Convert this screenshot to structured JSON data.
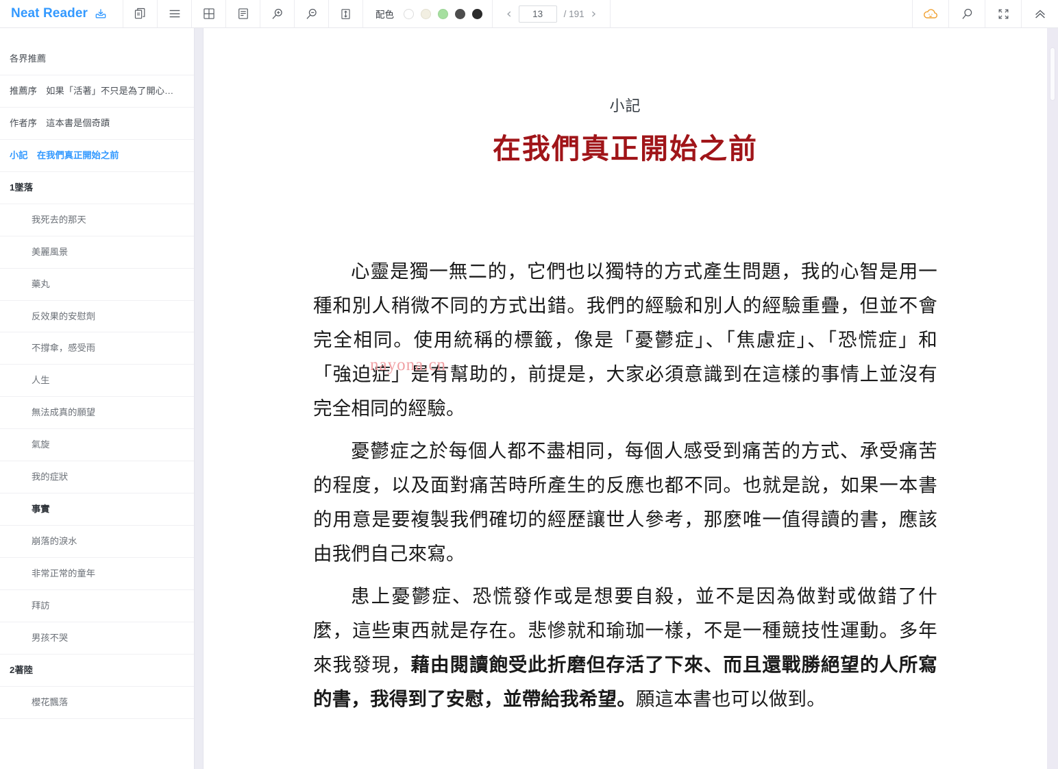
{
  "app": {
    "brand": "Neat Reader",
    "brand_color": "#3399ff",
    "brand_icon": "download-tray-icon"
  },
  "toolbar": {
    "buttons": [
      {
        "name": "pages-copy-icon",
        "title": "分頁"
      },
      {
        "name": "toc-list-icon",
        "title": "目錄"
      },
      {
        "name": "grid-layout-icon",
        "title": "編排"
      },
      {
        "name": "text-layout-icon",
        "title": "排版"
      },
      {
        "name": "zoom-in-icon",
        "title": "放大"
      },
      {
        "name": "zoom-out-icon",
        "title": "縮小"
      },
      {
        "name": "line-height-icon",
        "title": "行高"
      }
    ],
    "color_scheme": {
      "label": "配色",
      "swatches": [
        {
          "name": "scheme-white",
          "color": "#ffffff"
        },
        {
          "name": "scheme-cream",
          "color": "#f2efe2"
        },
        {
          "name": "scheme-green",
          "color": "#a6dfa0"
        },
        {
          "name": "scheme-gray",
          "color": "#4d4d4d"
        },
        {
          "name": "scheme-black",
          "color": "#2b2b2b"
        }
      ]
    },
    "pager": {
      "prev": "‹",
      "next": "›",
      "current_page": "13",
      "total": "/ 191"
    },
    "right_buttons": [
      {
        "name": "cloud-sync-icon",
        "title": "雲端"
      },
      {
        "name": "search-icon",
        "title": "搜尋"
      },
      {
        "name": "fullscreen-icon",
        "title": "全螢幕"
      },
      {
        "name": "collapse-up-icon",
        "title": "收起"
      }
    ],
    "cloud_color": "#f0a030"
  },
  "sidebar": {
    "items": [
      {
        "label": "各界推薦",
        "level": 1,
        "style": "normal",
        "active": false
      },
      {
        "label": "推薦序　如果「活著」不只是為了開心…",
        "level": 1,
        "style": "normal",
        "active": false
      },
      {
        "label": "作者序　這本書是個奇蹟",
        "level": 1,
        "style": "normal",
        "active": false
      },
      {
        "label": "小記　在我們真正開始之前",
        "level": 1,
        "style": "normal",
        "active": true
      },
      {
        "label": "1墜落",
        "level": 1,
        "style": "strong",
        "active": false
      },
      {
        "label": "我死去的那天",
        "level": 2,
        "style": "normal",
        "active": false
      },
      {
        "label": "美麗風景",
        "level": 2,
        "style": "normal",
        "active": false
      },
      {
        "label": "藥丸",
        "level": 2,
        "style": "normal",
        "active": false
      },
      {
        "label": "反效果的安慰劑",
        "level": 2,
        "style": "normal",
        "active": false
      },
      {
        "label": "不撐傘，感受雨",
        "level": 2,
        "style": "normal",
        "active": false
      },
      {
        "label": "人生",
        "level": 2,
        "style": "normal",
        "active": false
      },
      {
        "label": "無法成真的願望",
        "level": 2,
        "style": "normal",
        "active": false
      },
      {
        "label": "氣旋",
        "level": 2,
        "style": "normal",
        "active": false
      },
      {
        "label": "我的症狀",
        "level": 2,
        "style": "normal",
        "active": false
      },
      {
        "label": "事實",
        "level": 2,
        "style": "strong",
        "active": false
      },
      {
        "label": "崩落的淚水",
        "level": 2,
        "style": "normal",
        "active": false
      },
      {
        "label": "非常正常的童年",
        "level": 2,
        "style": "normal",
        "active": false
      },
      {
        "label": "拜訪",
        "level": 2,
        "style": "normal",
        "active": false
      },
      {
        "label": "男孩不哭",
        "level": 2,
        "style": "normal",
        "active": false
      },
      {
        "label": "2著陸",
        "level": 1,
        "style": "strong",
        "active": false
      },
      {
        "label": "櫻花飄落",
        "level": 2,
        "style": "normal",
        "active": false
      }
    ]
  },
  "content": {
    "chapter_label": "小記",
    "chapter_title": "在我們真正開始之前",
    "title_color": "#a01519",
    "watermark": "nayona.cn",
    "paragraphs": {
      "p1": "心靈是獨一無二的，它們也以獨特的方式產生問題，我的心智是用一種和別人稍微不同的方式出錯。我們的經驗和別人的經驗重疊，但並不會完全相同。使用統稱的標籤，像是「憂鬱症」、「焦慮症」、「恐慌症」和「強迫症」是有幫助的，前提是，大家必須意識到在這樣的事情上並沒有完全相同的經驗。",
      "p2": "憂鬱症之於每個人都不盡相同，每個人感受到痛苦的方式、承受痛苦的程度，以及面對痛苦時所產生的反應也都不同。也就是說，如果一本書的用意是要複製我們確切的經歷讓世人參考，那麼唯一值得讀的書，應該由我們自己來寫。",
      "p3_before": "患上憂鬱症、恐慌發作或是想要自殺，並不是因為做對或做錯了什麼，這些東西就是存在。悲慘就和瑜珈一樣，不是一種競技性運動。多年來我發現，",
      "p3_bold": "藉由閱讀飽受此折磨但存活了下來、而且還戰勝絕望的人所寫的書，我得到了安慰，並帶給我希望。",
      "p3_after": "願這本書也可以做到。"
    }
  }
}
